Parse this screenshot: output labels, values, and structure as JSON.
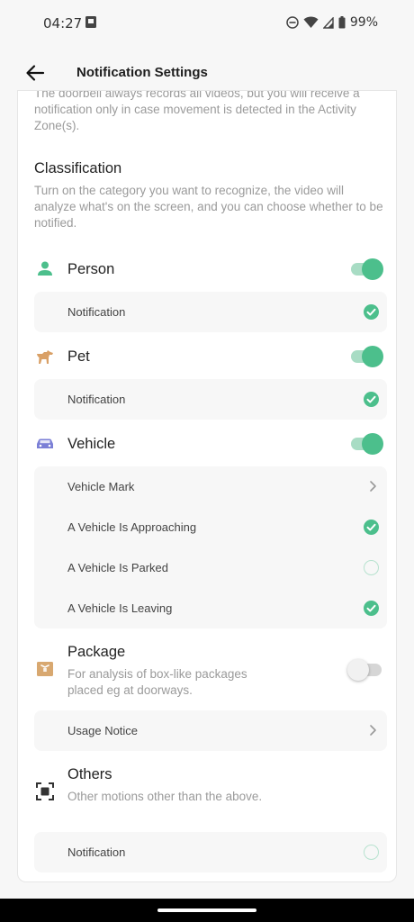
{
  "status_bar": {
    "time": "04:27",
    "battery": "99%"
  },
  "header": {
    "title": "Notification Settings"
  },
  "top_note": "The doorbell always records all videos, but you will receive a notification only in case movement is detected in the Activity Zone(s).",
  "classification": {
    "title": "Classification",
    "description": "Turn on the category you want to recognize, the video will analyze what's on the screen, and you can choose whether to be notified."
  },
  "person": {
    "label": "Person",
    "enabled": true,
    "rows": [
      {
        "label": "Notification",
        "checked": true
      }
    ]
  },
  "pet": {
    "label": "Pet",
    "enabled": true,
    "rows": [
      {
        "label": "Notification",
        "checked": true
      }
    ]
  },
  "vehicle": {
    "label": "Vehicle",
    "enabled": true,
    "rows": [
      {
        "label": "Vehicle Mark",
        "type": "link"
      },
      {
        "label": "A Vehicle Is Approaching",
        "checked": true
      },
      {
        "label": "A Vehicle Is Parked",
        "checked": false
      },
      {
        "label": "A Vehicle Is Leaving",
        "checked": true
      }
    ]
  },
  "package": {
    "label": "Package",
    "description": "For analysis of box-like packages placed eg at doorways.",
    "enabled": false,
    "rows": [
      {
        "label": "Usage Notice",
        "type": "link"
      }
    ]
  },
  "others": {
    "label": "Others",
    "description": "Other motions other than the above.",
    "rows": [
      {
        "label": "Notification",
        "checked": false
      }
    ]
  },
  "colors": {
    "accent": "#4cbf8c",
    "accent_light": "#a8dcc4",
    "pet_icon": "#d9a066",
    "vehicle_icon": "#7b7fd6",
    "package_icon": "#d8a870"
  },
  "icons": [
    "back-arrow-icon",
    "person-icon",
    "pet-icon",
    "car-icon",
    "package-icon",
    "others-icon",
    "checkmark-icon",
    "chevron-right-icon"
  ]
}
